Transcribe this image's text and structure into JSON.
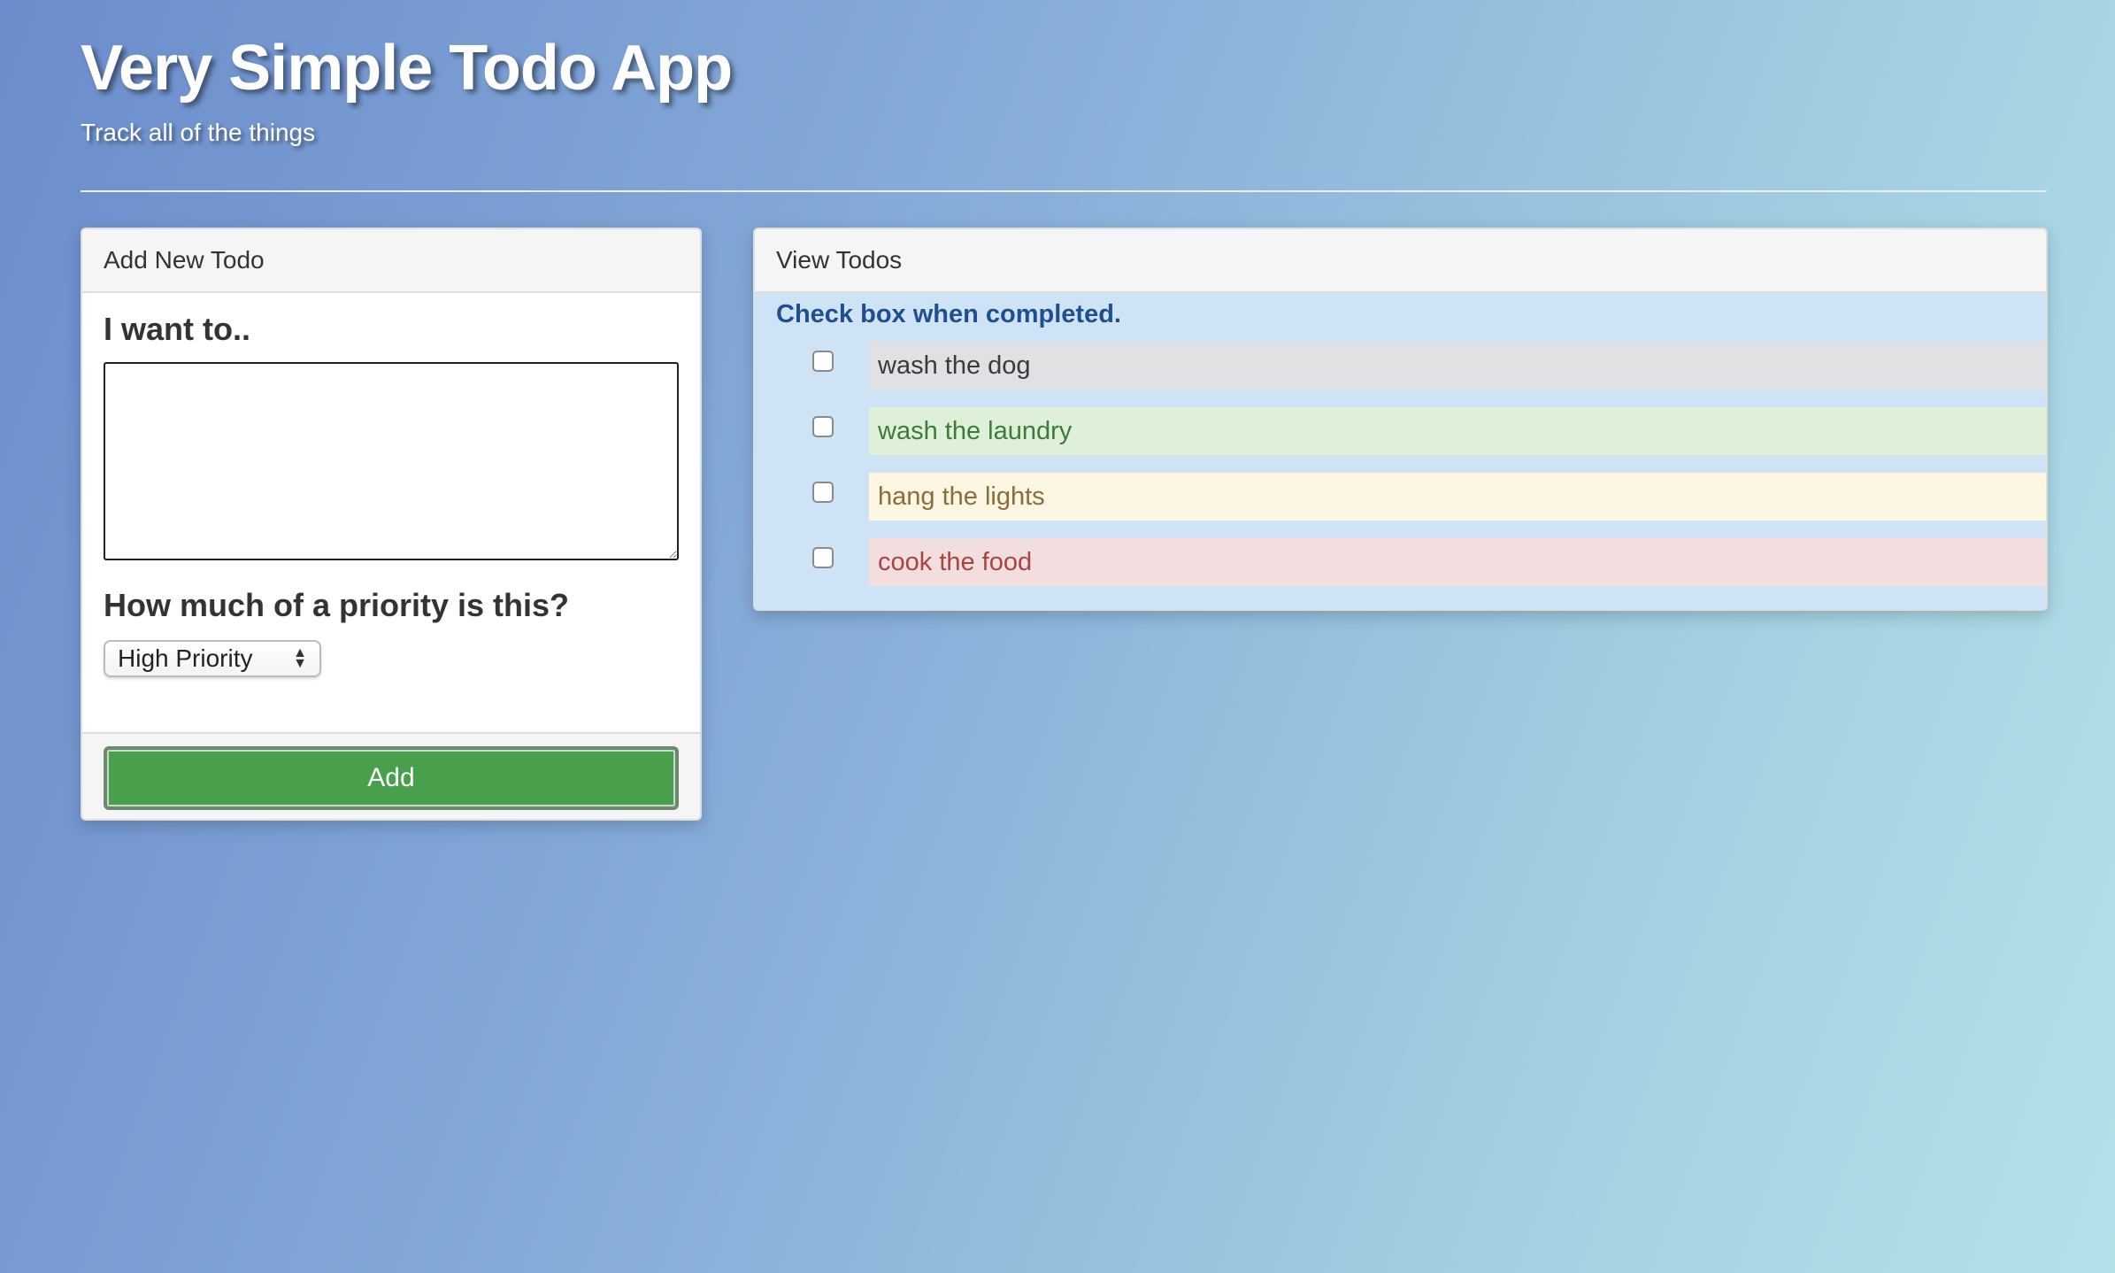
{
  "header": {
    "title": "Very Simple Todo App",
    "subtitle": "Track all of the things"
  },
  "add_panel": {
    "heading": "Add New Todo",
    "description_label": "I want to..",
    "description_value": "",
    "priority_label": "How much of a priority is this?",
    "priority_selected": "High Priority",
    "add_button_label": "Add"
  },
  "view_panel": {
    "heading": "View Todos",
    "hint": "Check box when completed.",
    "todos": [
      {
        "text": "wash the dog",
        "checked": false,
        "background": "#dfe1e3",
        "text_color": "#3a3a3a"
      },
      {
        "text": "wash the laundry",
        "checked": false,
        "background": "#dff0d8",
        "text_color": "#3c7a3d"
      },
      {
        "text": "hang the lights",
        "checked": false,
        "background": "#fcf6e2",
        "text_color": "#8a6d3b"
      },
      {
        "text": "cook the food",
        "checked": false,
        "background": "#f2dede",
        "text_color": "#a94442"
      }
    ]
  },
  "icons": {
    "edit": "pencil-icon",
    "delete": "eraser-icon"
  },
  "colors": {
    "add_button": "#48a04c",
    "hint_text": "#1f4f8f",
    "edit_button": "#f5b88f",
    "delete_button": "#f29aa6"
  }
}
